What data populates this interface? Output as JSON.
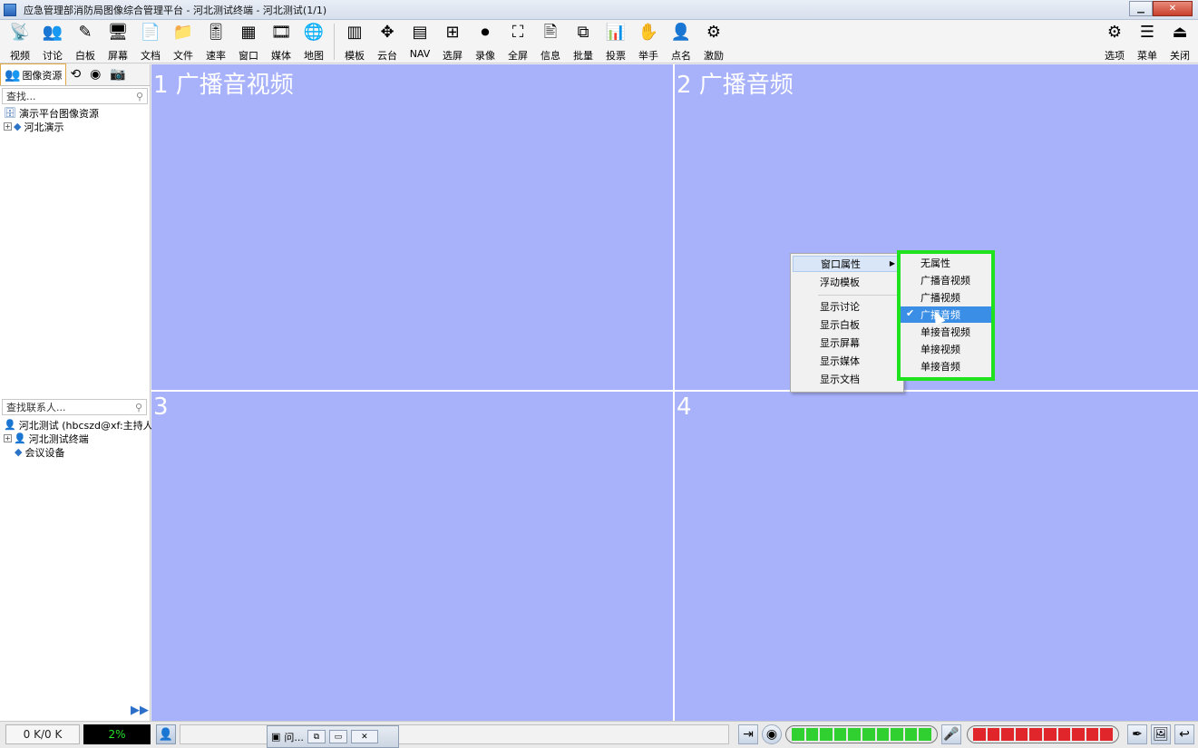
{
  "window": {
    "title": "应急管理部消防局图像综合管理平台 - 河北测试终端 - 河北测试(1/1)"
  },
  "toolbar": {
    "left": [
      {
        "label": "视频",
        "icon": "video-icon",
        "glyph": "📡"
      },
      {
        "label": "讨论",
        "icon": "discussion-icon",
        "glyph": "👥"
      },
      {
        "label": "白板",
        "icon": "whiteboard-icon",
        "glyph": "✎"
      },
      {
        "label": "屏幕",
        "icon": "screen-icon",
        "glyph": "🖥"
      },
      {
        "label": "文档",
        "icon": "document-icon",
        "glyph": "📄"
      },
      {
        "label": "文件",
        "icon": "file-icon",
        "glyph": "📁"
      },
      {
        "label": "速率",
        "icon": "rate-icon",
        "glyph": "🎚"
      },
      {
        "label": "窗口",
        "icon": "window-icon",
        "glyph": "▦"
      },
      {
        "label": "媒体",
        "icon": "media-icon",
        "glyph": "🎞"
      },
      {
        "label": "地图",
        "icon": "map-icon",
        "glyph": "🌐"
      }
    ],
    "middle": [
      {
        "label": "模板",
        "icon": "template-icon",
        "glyph": "▥"
      },
      {
        "label": "云台",
        "icon": "ptz-icon",
        "glyph": "✥"
      },
      {
        "label": "NAV",
        "icon": "nav-icon",
        "glyph": "▤"
      },
      {
        "label": "选屏",
        "icon": "select-screen-icon",
        "glyph": "⊞"
      },
      {
        "label": "录像",
        "icon": "record-icon",
        "glyph": "⏺"
      },
      {
        "label": "全屏",
        "icon": "fullscreen-icon",
        "glyph": "⛶"
      },
      {
        "label": "信息",
        "icon": "info-icon",
        "glyph": "🖹"
      },
      {
        "label": "批量",
        "icon": "batch-icon",
        "glyph": "⧉"
      },
      {
        "label": "投票",
        "icon": "vote-icon",
        "glyph": "📊"
      },
      {
        "label": "举手",
        "icon": "raise-hand-icon",
        "glyph": "✋"
      },
      {
        "label": "点名",
        "icon": "roll-call-icon",
        "glyph": "👤"
      },
      {
        "label": "激励",
        "icon": "incentive-icon",
        "glyph": "⚙"
      }
    ],
    "right": [
      {
        "label": "选项",
        "icon": "options-gear-icon",
        "glyph": "⚙"
      },
      {
        "label": "菜单",
        "icon": "menu-icon",
        "glyph": "☰"
      },
      {
        "label": "关闭",
        "icon": "close-exit-icon",
        "glyph": "⏏"
      }
    ]
  },
  "left_panel": {
    "tab_label": "图像资源",
    "search_placeholder": "查找...",
    "resource_root": "演示平台图像资源",
    "resource_child": "河北演示",
    "contact_search_placeholder": "查找联系人...",
    "contact_root": "河北测试 (hbcszd@xf:主持人)",
    "contact_child1": "河北测试终端",
    "contact_child2": "会议设备"
  },
  "video_cells": [
    {
      "label": "1 广播音视频"
    },
    {
      "label": "2 广播音频"
    },
    {
      "label": "3"
    },
    {
      "label": "4"
    }
  ],
  "context_menu": {
    "items": [
      "窗口属性",
      "浮动模板",
      "显示讨论",
      "显示白板",
      "显示屏幕",
      "显示媒体",
      "显示文档"
    ]
  },
  "submenu": {
    "items": [
      "无属性",
      "广播音视频",
      "广播视频",
      "广播音频",
      "单接音视频",
      "单接视频",
      "单接音频"
    ],
    "selected_index": 3,
    "check_glyph": "✔"
  },
  "status": {
    "bandwidth": "0 K/0 K",
    "percent": "2%",
    "taskbar_title": "问..."
  },
  "colors": {
    "video_bg": "#a8b2fb",
    "highlight_green": "#1fe21f",
    "meter_green": "#2fd02f",
    "meter_red": "#e0252b"
  }
}
